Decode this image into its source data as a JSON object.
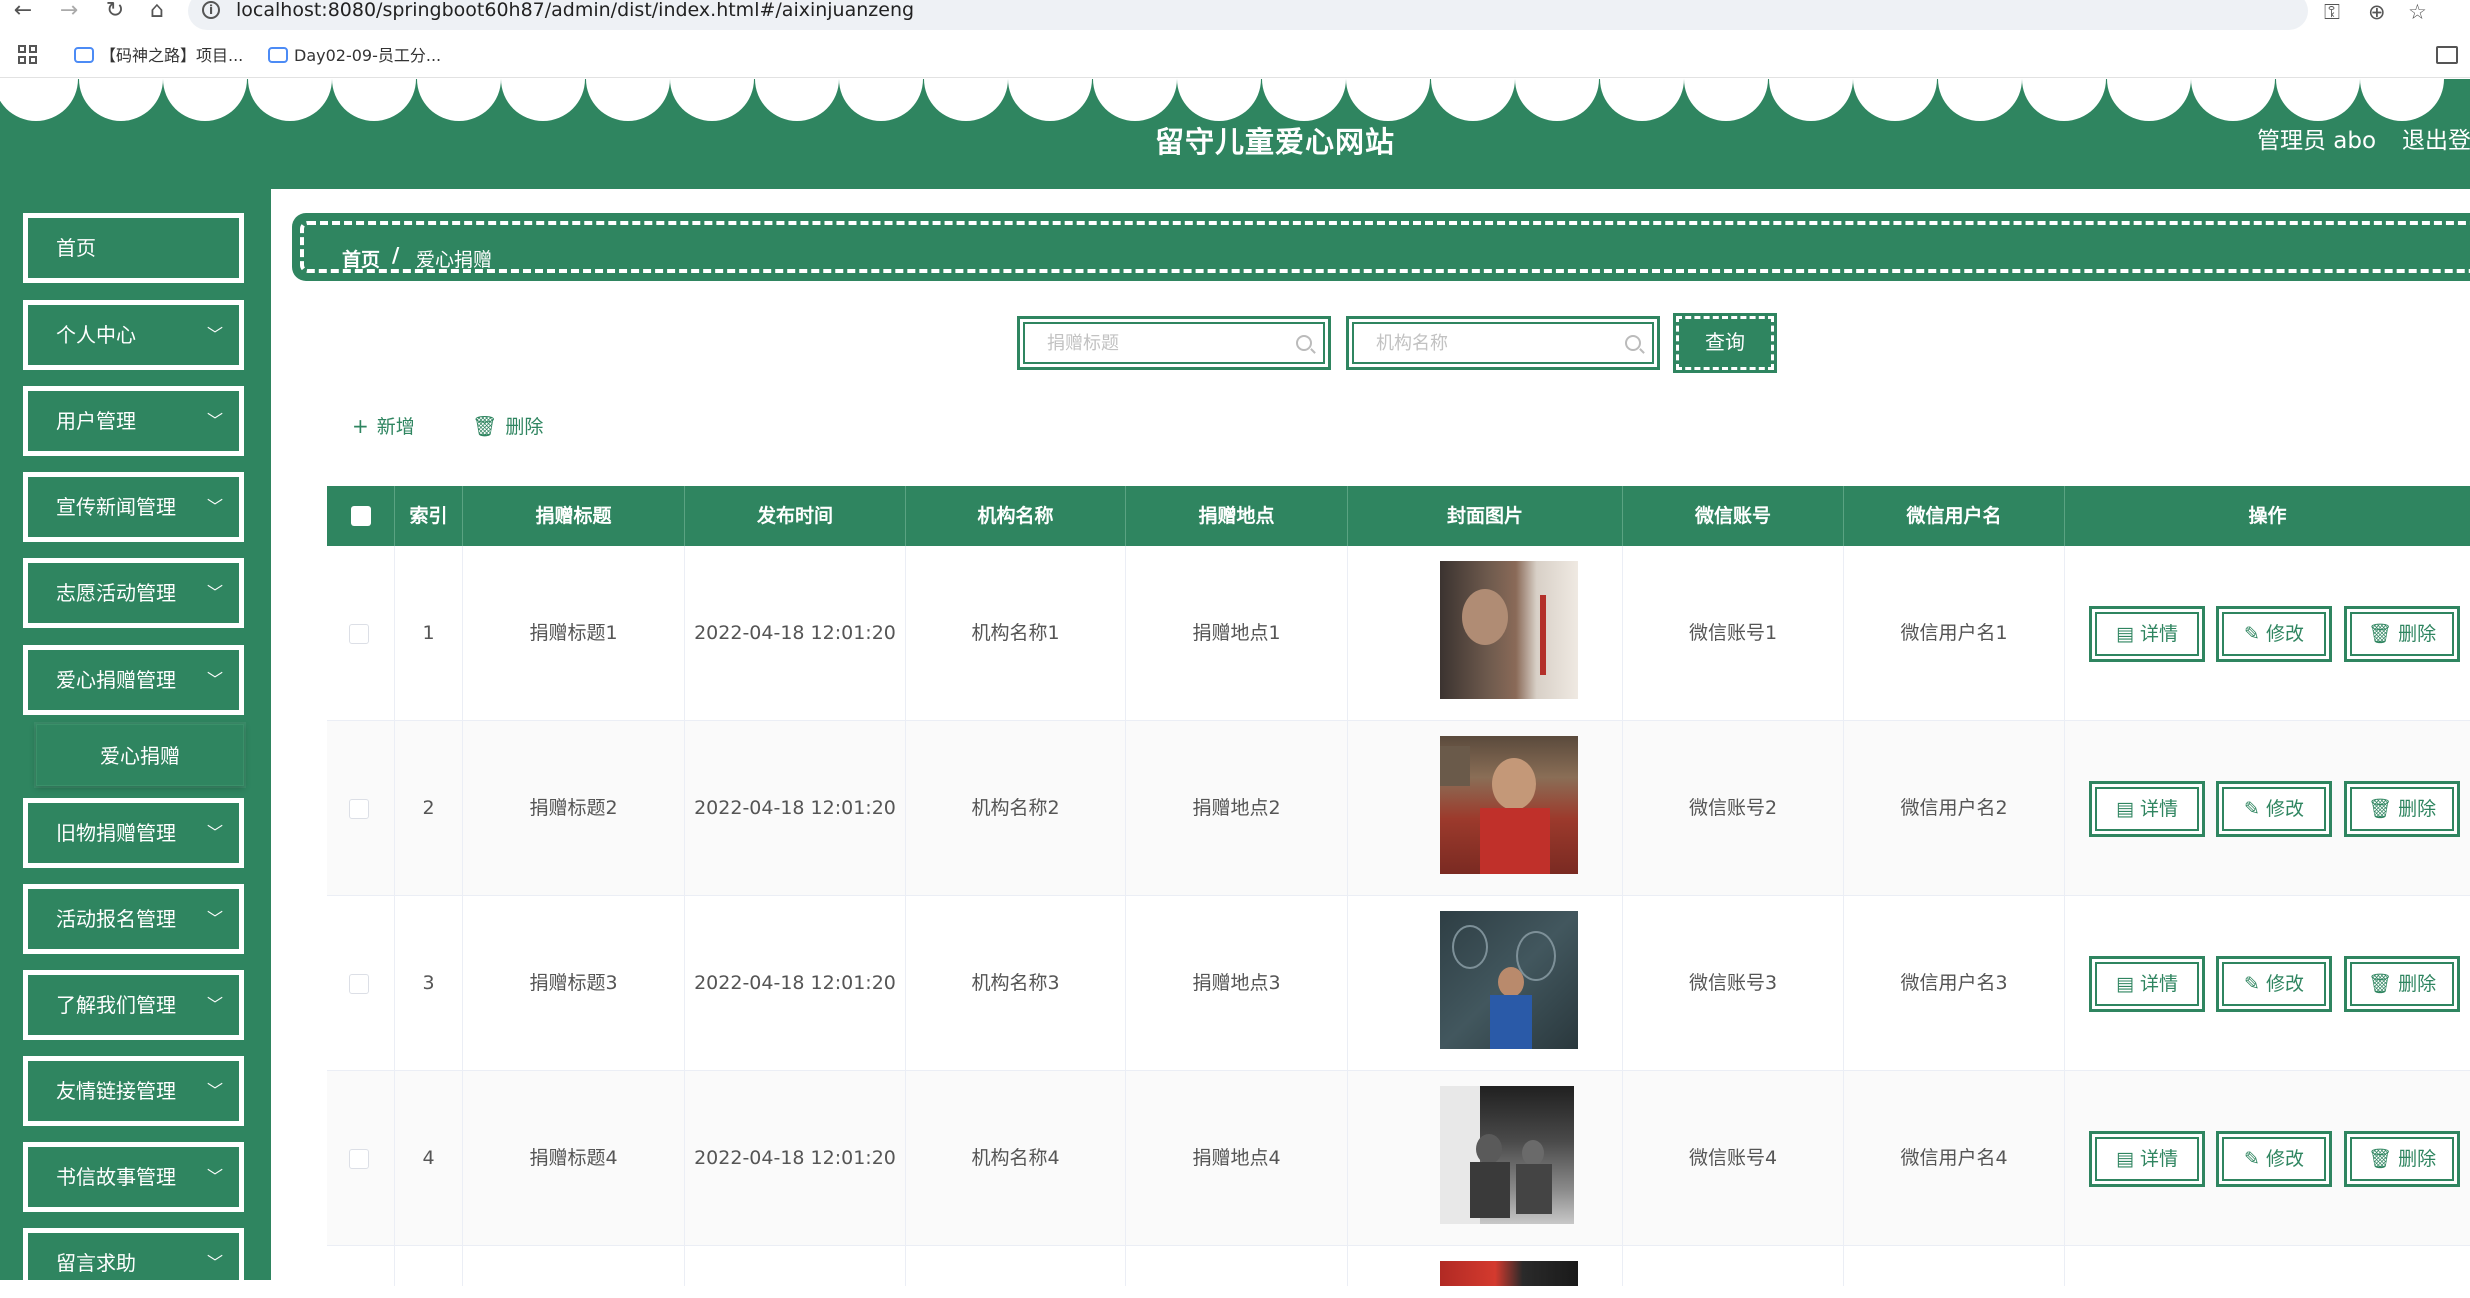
{
  "browser": {
    "url": "localhost:8080/springboot60h87/admin/dist/index.html#/aixinjuanzeng",
    "bookmarks": [
      "【码神之路】项目...",
      "Day02-09-员工分..."
    ]
  },
  "header": {
    "title": "留守儿童爱心网站",
    "user": "管理员 abo",
    "logout": "退出登"
  },
  "sidebar": {
    "items": [
      {
        "label": "首页",
        "expandable": false
      },
      {
        "label": "个人中心",
        "expandable": true
      },
      {
        "label": "用户管理",
        "expandable": true
      },
      {
        "label": "宣传新闻管理",
        "expandable": true
      },
      {
        "label": "志愿活动管理",
        "expandable": true
      },
      {
        "label": "爱心捐赠管理",
        "expandable": true
      },
      {
        "label": "旧物捐赠管理",
        "expandable": true
      },
      {
        "label": "活动报名管理",
        "expandable": true
      },
      {
        "label": "了解我们管理",
        "expandable": true
      },
      {
        "label": "友情链接管理",
        "expandable": true
      },
      {
        "label": "书信故事管理",
        "expandable": true
      },
      {
        "label": "留言求助",
        "expandable": true
      }
    ],
    "submenu_label": "爱心捐赠"
  },
  "breadcrumb": {
    "home": "首页",
    "separator": "/",
    "current": "爱心捐赠"
  },
  "search": {
    "title_placeholder": "捐赠标题",
    "org_placeholder": "机构名称",
    "query_label": "查询"
  },
  "toolbar": {
    "add_label": "新增",
    "delete_label": "删除"
  },
  "table": {
    "columns": [
      "索引",
      "捐赠标题",
      "发布时间",
      "机构名称",
      "捐赠地点",
      "封面图片",
      "微信账号",
      "微信用户名",
      "操作"
    ],
    "rows": [
      {
        "index": "1",
        "title": "捐赠标题1",
        "time": "2022-04-18 12:01:20",
        "org": "机构名称1",
        "place": "捐赠地点1",
        "wechat": "微信账号1",
        "wechat_name": "微信用户名1"
      },
      {
        "index": "2",
        "title": "捐赠标题2",
        "time": "2022-04-18 12:01:20",
        "org": "机构名称2",
        "place": "捐赠地点2",
        "wechat": "微信账号2",
        "wechat_name": "微信用户名2"
      },
      {
        "index": "3",
        "title": "捐赠标题3",
        "time": "2022-04-18 12:01:20",
        "org": "机构名称3",
        "place": "捐赠地点3",
        "wechat": "微信账号3",
        "wechat_name": "微信用户名3"
      },
      {
        "index": "4",
        "title": "捐赠标题4",
        "time": "2022-04-18 12:01:20",
        "org": "机构名称4",
        "place": "捐赠地点4",
        "wechat": "微信账号4",
        "wechat_name": "微信用户名4"
      }
    ],
    "actions": {
      "detail": "详情",
      "edit": "修改",
      "delete": "删除"
    }
  },
  "colors": {
    "primary": "#2f8560",
    "white": "#ffffff"
  }
}
